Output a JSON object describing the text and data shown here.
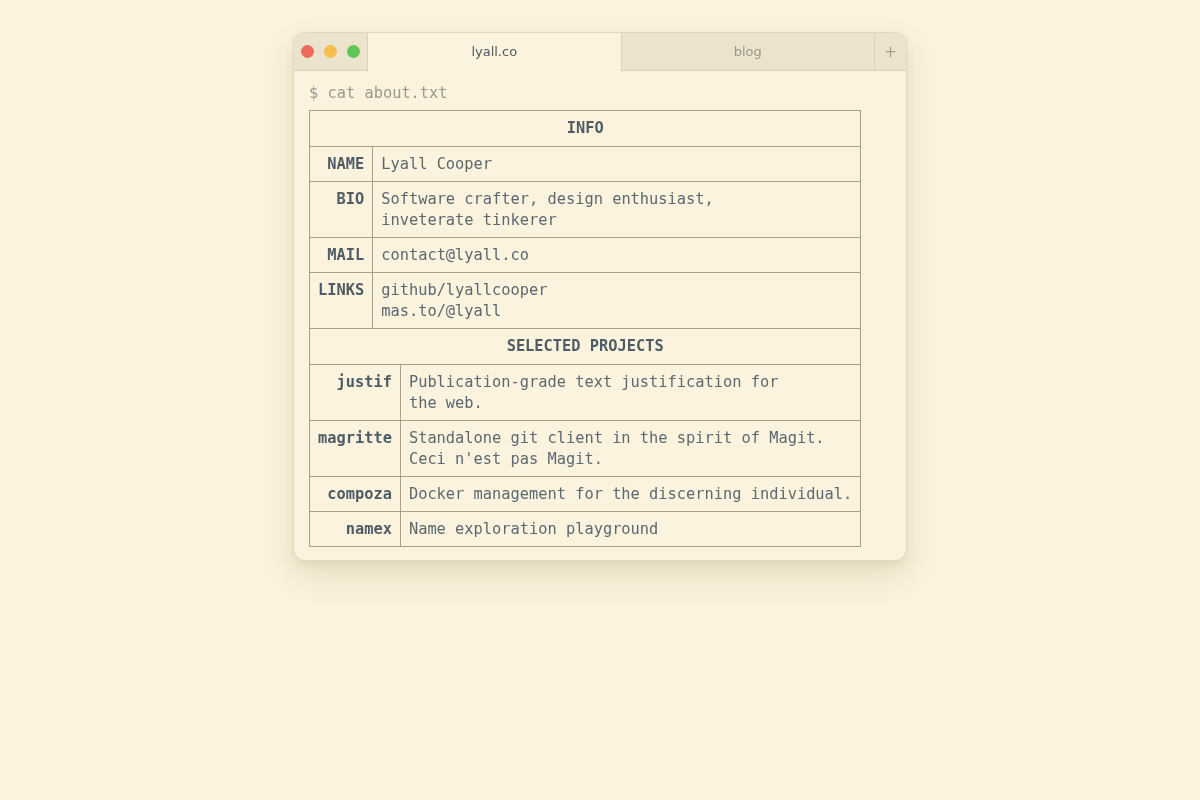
{
  "window_controls": [
    {
      "color": "#ec6a5e"
    },
    {
      "color": "#f4bf4f"
    },
    {
      "color": "#61c554"
    }
  ],
  "tabs": [
    {
      "label": "lyall.co",
      "selected": true
    },
    {
      "label": "blog",
      "selected": false
    }
  ],
  "new_tab_button": {
    "label": "+"
  },
  "terminal": {
    "command": "$ cat about.txt",
    "sections": [
      {
        "title": "INFO",
        "rows": [
          {
            "kind": "text",
            "label": "NAME",
            "value": "Lyall Cooper"
          },
          {
            "kind": "text",
            "label": "BIO",
            "value": "Software crafter, design enthusiast,\ninveterate tinkerer"
          },
          {
            "kind": "text",
            "label": "MAIL",
            "value": "contact@lyall.co"
          },
          {
            "kind": "links",
            "label": "LINKS",
            "links": [
              "github/lyallcooper",
              "mas.to/@lyall"
            ]
          }
        ]
      },
      {
        "title": "SELECTED PROJECTS",
        "rows": [
          {
            "kind": "text",
            "label": "justif",
            "value": "Publication-grade text justification for\nthe web."
          },
          {
            "kind": "text",
            "label": "magritte",
            "value": "Standalone git client in the spirit of Magit.\nCeci n'est pas Magit."
          },
          {
            "kind": "text",
            "label": "compoza",
            "value": "Docker management for the discerning individual."
          },
          {
            "kind": "text",
            "label": "namex",
            "value": "Name exploration playground"
          }
        ]
      }
    ]
  }
}
